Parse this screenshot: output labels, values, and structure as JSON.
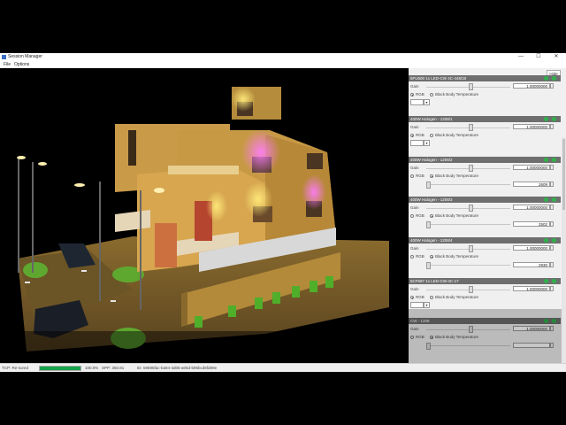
{
  "window": {
    "title": "Session Manager",
    "minimize": "—",
    "maximize": "☐",
    "close": "✕"
  },
  "menu": {
    "file": "File",
    "options": "Options"
  },
  "panel": {
    "hide_label": "Hide",
    "lights": [
      {
        "name": "5FU600 1x LED-CW 4C-448CB",
        "gain_label": "Gain",
        "gain": "1.00000000",
        "rgb_label": "RGB",
        "bbt_label": "Black Body Temperature",
        "mode": "rgb",
        "temperature": ""
      },
      {
        "name": "400W Halogen - 1208/1",
        "gain_label": "Gain",
        "gain": "1.00000000",
        "rgb_label": "RGB",
        "bbt_label": "Black Body Temperature",
        "mode": "rgb",
        "temperature": ""
      },
      {
        "name": "400W Halogen - 1208/2",
        "gain_label": "Gain",
        "gain": "1.00000000",
        "rgb_label": "RGB",
        "bbt_label": "Black Body Temperature",
        "mode": "bbt",
        "temperature": "2609"
      },
      {
        "name": "400W Halogen - 1208/3",
        "gain_label": "Gain",
        "gain": "1.00000000",
        "rgb_label": "RGB",
        "bbt_label": "Black Body Temperature",
        "mode": "bbt",
        "temperature": "2502"
      },
      {
        "name": "400W Halogen - 1208/4",
        "gain_label": "Gain",
        "gain": "1.00000000",
        "rgb_label": "RGB",
        "bbt_label": "Black Body Temperature",
        "mode": "bbt",
        "temperature": "2930"
      },
      {
        "name": "5CF597 1x LED-CW-4C-17",
        "gain_label": "Gain",
        "gain": "1.00000000",
        "rgb_label": "RGB",
        "bbt_label": "Black Body Temperature",
        "mode": "rgb",
        "temperature": ""
      },
      {
        "name": "CW - 1208",
        "gain_label": "Gain",
        "gain": "1.00000000",
        "rgb_label": "RGB",
        "bbt_label": "Black Body Temperature",
        "mode": "bbt",
        "temperature": ""
      }
    ]
  },
  "status": {
    "fps": "TCP: Re-sored",
    "progress_percent": 100,
    "progress_text": "100.0%",
    "spp": "SPP: 350.81",
    "session_id": "ID: 59695fac-ba94-4d05-a05d-b95bcd5fd89e"
  },
  "colors": {
    "status_ok": "#2db34a",
    "progress": "#16a34a",
    "header": "#6e6e6e"
  }
}
